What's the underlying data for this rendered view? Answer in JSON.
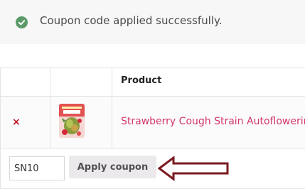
{
  "notice": {
    "message": "Coupon code applied successfully.",
    "icon": "check-circle-icon",
    "icon_color": "#5b9a68"
  },
  "cart": {
    "header": {
      "product": "Product"
    },
    "rows": [
      {
        "remove_symbol": "×",
        "product_name": "Strawberry Cough Strain Autoflowering",
        "thumbnail_icon": "product-thumbnail"
      }
    ],
    "coupon": {
      "value": "SN10",
      "button_label": "Apply coupon"
    }
  },
  "annotation": {
    "icon": "arrow-left-icon",
    "color": "#7a1a1f"
  },
  "colors": {
    "link": "#d3366b",
    "remove": "#c1121f"
  }
}
